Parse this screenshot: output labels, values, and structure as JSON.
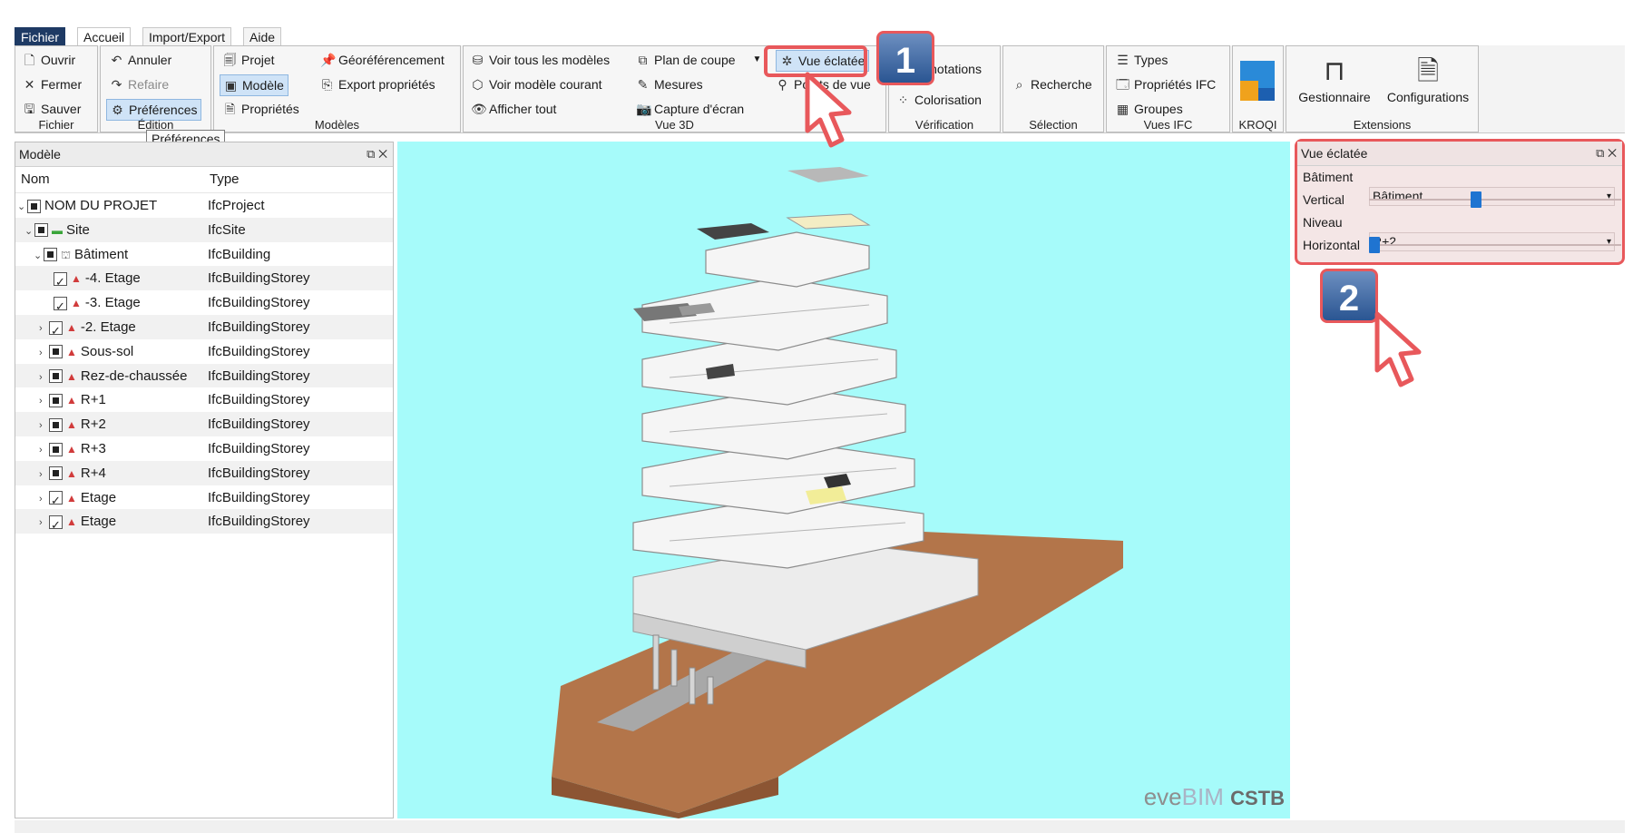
{
  "menu": {
    "tabs": [
      "Fichier",
      "Accueil",
      "Import/Export",
      "Aide"
    ]
  },
  "ribbon": {
    "fichier": {
      "label": "Fichier",
      "ouvrir": "Ouvrir",
      "fermer": "Fermer",
      "sauver": "Sauver"
    },
    "edition": {
      "label": "Édition",
      "annuler": "Annuler",
      "refaire": "Refaire",
      "preferences": "Préférences"
    },
    "modeles": {
      "label": "Modèles",
      "projet": "Projet",
      "modele": "Modèle",
      "proprietes": "Propriétés",
      "georef": "Géoréférencement",
      "export": "Export propriétés"
    },
    "vue3d": {
      "label": "Vue 3D",
      "voir_tous": "Voir tous les modèles",
      "voir_courant": "Voir modèle courant",
      "afficher_tout": "Afficher tout",
      "plan_coupe": "Plan de coupe",
      "mesures": "Mesures",
      "capture": "Capture d'écran",
      "vue_eclatee": "Vue éclatée",
      "points_vue": "Points de vue"
    },
    "verification": {
      "label": "Vérification",
      "annotations": "Annotations",
      "colorisation": "Colorisation"
    },
    "selection": {
      "label": "Sélection",
      "recherche": "Recherche"
    },
    "vues_ifc": {
      "label": "Vues IFC",
      "types": "Types",
      "proprietes_ifc": "Propriétés IFC",
      "groupes": "Groupes"
    },
    "kroqi": {
      "label": "KROQI"
    },
    "extensions": {
      "label": "Extensions",
      "gestionnaire": "Gestionnaire",
      "configurations": "Configurations"
    }
  },
  "tooltip": "Préférences",
  "model_panel": {
    "title": "Modèle",
    "columns": [
      "Nom",
      "Type"
    ],
    "rows": [
      {
        "name": "NOM DU PROJET",
        "type": "IfcProject"
      },
      {
        "name": "Site",
        "type": "IfcSite"
      },
      {
        "name": "Bâtiment",
        "type": "IfcBuilding"
      },
      {
        "name": "-4. Etage",
        "type": "IfcBuildingStorey"
      },
      {
        "name": "-3. Etage",
        "type": "IfcBuildingStorey"
      },
      {
        "name": "-2. Etage",
        "type": "IfcBuildingStorey"
      },
      {
        "name": "Sous-sol",
        "type": "IfcBuildingStorey"
      },
      {
        "name": "Rez-de-chaussée",
        "type": "IfcBuildingStorey"
      },
      {
        "name": "R+1",
        "type": "IfcBuildingStorey"
      },
      {
        "name": "R+2",
        "type": "IfcBuildingStorey"
      },
      {
        "name": "R+3",
        "type": "IfcBuildingStorey"
      },
      {
        "name": "R+4",
        "type": "IfcBuildingStorey"
      },
      {
        "name": "Etage",
        "type": "IfcBuildingStorey"
      },
      {
        "name": "Etage",
        "type": "IfcBuildingStorey"
      }
    ]
  },
  "exploded_panel": {
    "title": "Vue éclatée",
    "batiment_label": "Bâtiment",
    "batiment_value": "Bâtiment",
    "vertical_label": "Vertical",
    "vertical_level": 0.42,
    "niveau_label": "Niveau",
    "niveau_value": "R+2",
    "horizontal_label": "Horizontal",
    "horizontal_level": 0.0
  },
  "callouts": [
    "1",
    "2"
  ],
  "watermark": {
    "eve": "eve",
    "bim": "BIM",
    "cstb": "CSTB"
  },
  "colors": {
    "viewport_bg": "#a6fbfa",
    "highlight": "#e8585b",
    "terrain": "#b3754a",
    "selected": "#cfe3f7"
  }
}
